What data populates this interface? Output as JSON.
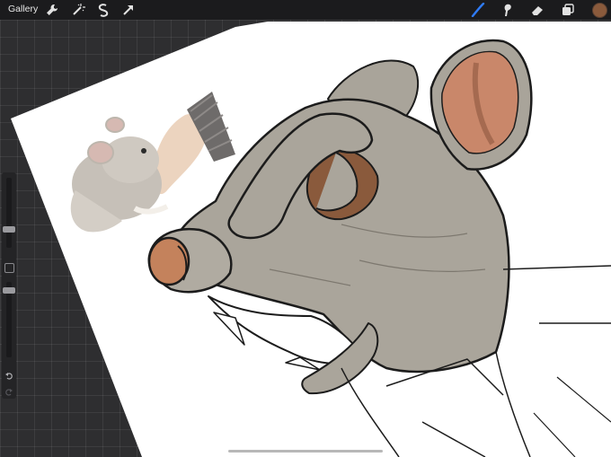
{
  "topbar": {
    "gallery_label": "Gallery",
    "left_icons": [
      "wrench-icon",
      "magic-wand-icon",
      "selection-icon",
      "transform-arrow-icon"
    ],
    "right_icons": [
      "brush-icon",
      "smudge-icon",
      "eraser-icon",
      "layers-icon"
    ],
    "active_tool": "brush-icon",
    "accent_color": "#2f7bf6",
    "current_color": "#8a5a3c"
  },
  "sidebar": {
    "brush_size_slider": "brush-size-slider",
    "modify_button": "modify-button",
    "opacity_slider": "opacity-slider",
    "undo": "undo-icon",
    "redo": "redo-icon"
  },
  "canvas": {
    "paper_color": "#ffffff",
    "rat_fill": "#a9a49a",
    "ear_inner": "#c9876a",
    "nose": "#c4825c"
  }
}
